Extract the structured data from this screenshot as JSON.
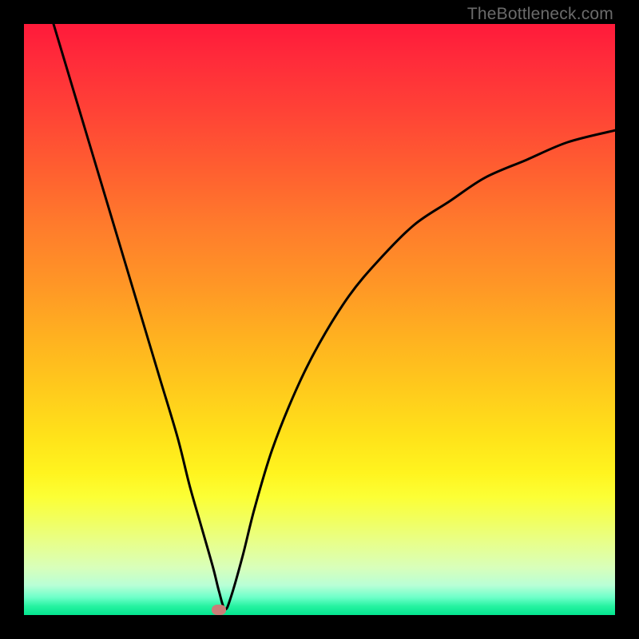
{
  "attribution": "TheBottleneck.com",
  "colors": {
    "background": "#000000",
    "gradient_top": "#ff1a3a",
    "gradient_bottom": "#04e58f",
    "curve": "#000000",
    "marker": "#cb7d78",
    "attribution": "#6b6b6b"
  },
  "chart_data": {
    "type": "line",
    "title": "",
    "xlabel": "",
    "ylabel": "",
    "xlim": [
      0,
      100
    ],
    "ylim": [
      0,
      100
    ],
    "series": [
      {
        "name": "bottleneck-curve",
        "x": [
          5,
          8,
          11,
          14,
          17,
          20,
          23,
          26,
          28,
          30,
          32,
          33,
          34,
          35,
          37,
          39,
          42,
          46,
          50,
          55,
          60,
          66,
          72,
          78,
          85,
          92,
          100
        ],
        "y": [
          100,
          90,
          80,
          70,
          60,
          50,
          40,
          30,
          22,
          15,
          8,
          4,
          1,
          3,
          10,
          18,
          28,
          38,
          46,
          54,
          60,
          66,
          70,
          74,
          77,
          80,
          82
        ]
      }
    ],
    "marker": {
      "x": 33,
      "y": 1
    },
    "legend": false,
    "grid": false
  }
}
